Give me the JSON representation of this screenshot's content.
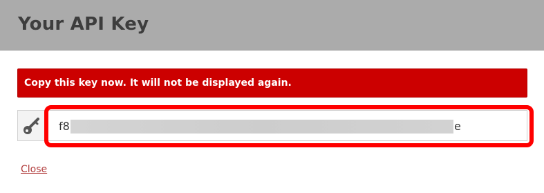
{
  "dialog": {
    "title": "Your API Key"
  },
  "alert": {
    "message": "Copy this key now. It will not be displayed again.",
    "color": "#cc0000"
  },
  "api_key": {
    "icon": "key-icon",
    "visible_prefix": "f8",
    "visible_suffix": "e",
    "redacted": true
  },
  "highlight": {
    "color": "#ff0000"
  },
  "actions": {
    "close_label": "Close"
  }
}
